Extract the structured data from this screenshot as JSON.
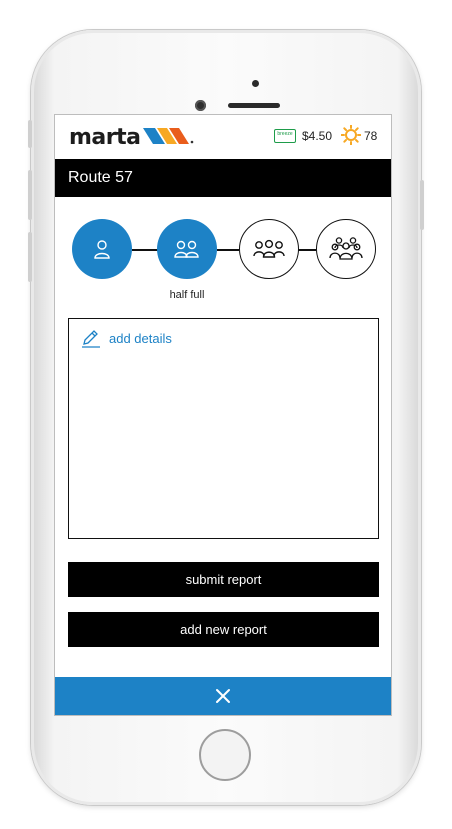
{
  "header": {
    "logo_text": "marta",
    "breeze_card_label": "breeze",
    "fare": "$4.50",
    "temperature": "78",
    "weather_icon": "sun-icon",
    "accent_colors": [
      "#1d82c6",
      "#f7a823",
      "#e95d1c"
    ]
  },
  "route": {
    "title": "Route 57"
  },
  "capacity": {
    "levels": [
      {
        "icon": "person-icon",
        "selected": true
      },
      {
        "icon": "two-people-icon",
        "selected": true
      },
      {
        "icon": "three-people-icon",
        "selected": false
      },
      {
        "icon": "crowd-icon",
        "selected": false
      }
    ],
    "selected_label": "half full",
    "selected_color": "#1d82c6"
  },
  "details": {
    "add_details_label": "add details",
    "icon": "pencil-icon"
  },
  "actions": {
    "submit_label": "submit report",
    "add_new_label": "add new report"
  },
  "footer": {
    "close_icon": "close-icon"
  }
}
